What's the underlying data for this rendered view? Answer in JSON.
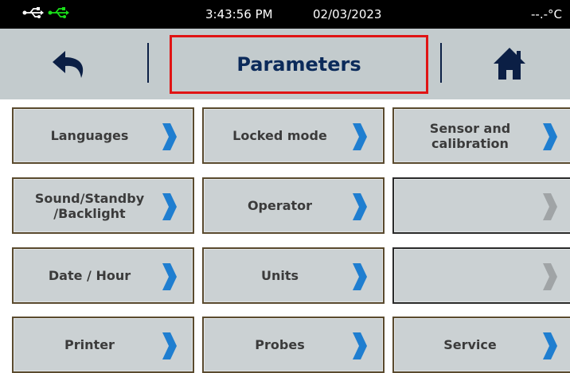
{
  "status": {
    "time": "3:43:56 PM",
    "date": "02/03/2023",
    "temperature": "--.-°C",
    "usb_color": "#ffffff",
    "usb_active_color": "#19e019"
  },
  "header": {
    "title": "Parameters",
    "back_icon": "back-arrow-icon",
    "home_icon": "home-icon",
    "highlight_color": "#e01414"
  },
  "menu": {
    "items": [
      {
        "label": "Languages",
        "enabled": true
      },
      {
        "label": "Locked mode",
        "enabled": true
      },
      {
        "label": "Sensor and\ncalibration",
        "enabled": true
      },
      {
        "label": "Sound/Standby\n/Backlight",
        "enabled": true
      },
      {
        "label": "Operator",
        "enabled": true
      },
      {
        "label": "",
        "enabled": false
      },
      {
        "label": "Date / Hour",
        "enabled": true
      },
      {
        "label": "Units",
        "enabled": true
      },
      {
        "label": "",
        "enabled": false
      },
      {
        "label": "Printer",
        "enabled": true
      },
      {
        "label": "Probes",
        "enabled": true
      },
      {
        "label": "Service",
        "enabled": true
      }
    ],
    "chevron_color": "#1f7ed0",
    "chevron_disabled_color": "#a0a4a6"
  }
}
